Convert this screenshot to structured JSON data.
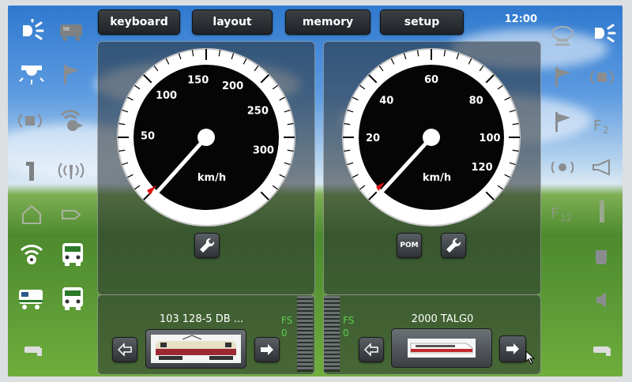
{
  "menu": {
    "keyboard": "keyboard",
    "layout": "layout",
    "memory": "memory",
    "setup": "setup"
  },
  "clock": "12:00",
  "gauges": {
    "left": {
      "ticks": [
        "50",
        "100",
        "150",
        "200",
        "250",
        "300"
      ],
      "unit": "km/h",
      "speed": 0
    },
    "right": {
      "ticks": [
        "20",
        "40",
        "60",
        "80",
        "100",
        "120"
      ],
      "unit": "km/h",
      "speed": 0,
      "pom_label": "POM"
    }
  },
  "locos": {
    "left": {
      "name": "103 128-5 DB ...",
      "fs_label": "FS",
      "fs_value": "0"
    },
    "right": {
      "name": "2000 TALG0",
      "fs_label": "FS",
      "fs_value": "0"
    }
  },
  "side_icons": {
    "left": [
      "light-icon",
      "loco-icon",
      "ceiling-light-icon",
      "flag-icon",
      "horn-sound-icon",
      "fan-icon",
      "info-icon",
      "antenna-icon",
      "house-icon",
      "arrow-icon",
      "wifi-sound-icon",
      "train-front-icon",
      "loco-side-icon",
      "train-front-icon"
    ],
    "right": [
      "speech-bubble-icon",
      "light-icon",
      "flag-icon",
      "horn-sound-icon",
      "flag-icon",
      "f2-icon",
      "fan-icon",
      "horn-icon",
      "f12-icon",
      "bar-icon",
      "cup-icon",
      "speaker-icon",
      "whistle-icon",
      "whistle-icon"
    ]
  }
}
